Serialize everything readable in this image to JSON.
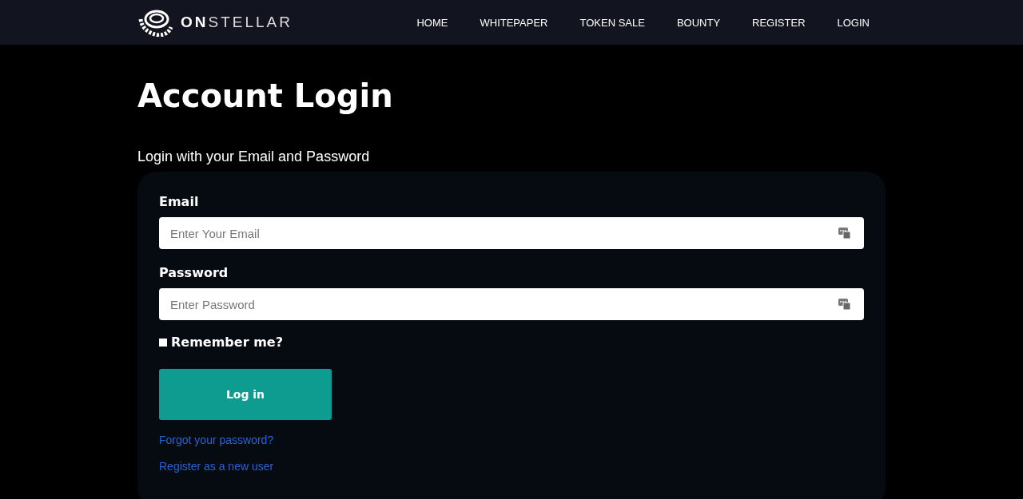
{
  "nav": {
    "logo": "**ON**STELLAR",
    "links": [
      {
        "label": "HOME",
        "selected": false
      },
      {
        "label": "WHITEPAPER",
        "selected": false
      },
      {
        "label": "TOKEN SALE",
        "selected": false
      },
      {
        "label": "BOUNTY",
        "selected": false
      },
      {
        "label": "REGISTER",
        "selected": false
      },
      {
        "label": "LOGIN",
        "selected": false
      }
    ]
  },
  "title": "Account Login",
  "subtitle": "Login with your Email and Password",
  "form": {
    "fields": [
      {
        "label": "Email",
        "placeholder": "Enter Your Email"
      },
      {
        "label": "Password",
        "placeholder": "Enter Password"
      }
    ],
    "remember": {
      "label": "Remember me?",
      "checked": false
    },
    "submit": "Log in",
    "links": [
      "Forgot your password?",
      "Register as a new user"
    ]
  }
}
